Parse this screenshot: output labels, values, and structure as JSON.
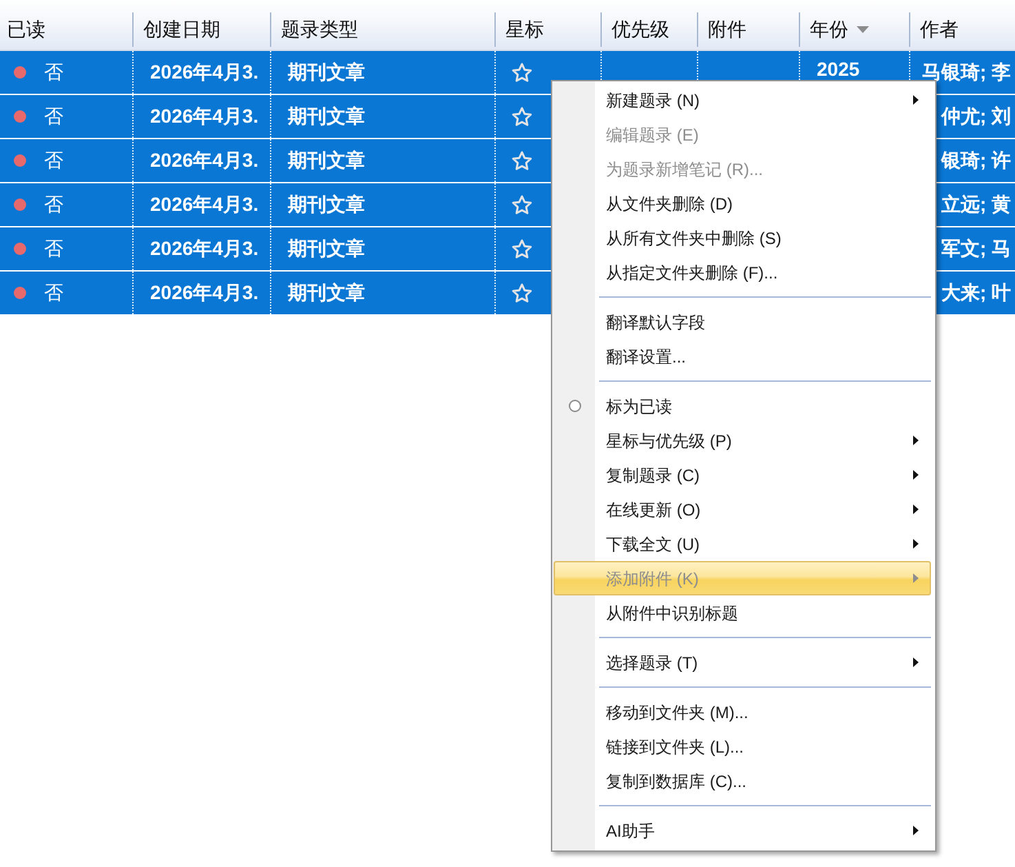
{
  "table": {
    "columns": [
      {
        "label": "已读"
      },
      {
        "label": "创建日期"
      },
      {
        "label": "题录类型"
      },
      {
        "label": "星标"
      },
      {
        "label": "优先级"
      },
      {
        "label": "附件"
      },
      {
        "label": "年份",
        "sorted": true,
        "descending": true
      },
      {
        "label": "作者"
      }
    ],
    "rows": [
      {
        "selected": true,
        "unread": true,
        "read": "否",
        "created": "2026年4月3.",
        "type": "期刊文章",
        "starred": false,
        "year": "2025",
        "authors": "马银琦; 李"
      },
      {
        "selected": true,
        "unread": true,
        "read": "否",
        "created": "2026年4月3.",
        "type": "期刊文章",
        "starred": false,
        "authors": "仲尤; 刘"
      },
      {
        "selected": true,
        "unread": true,
        "read": "否",
        "created": "2026年4月3.",
        "type": "期刊文章",
        "starred": false,
        "authors": "银琦; 许"
      },
      {
        "selected": true,
        "unread": true,
        "read": "否",
        "created": "2026年4月3.",
        "type": "期刊文章",
        "starred": false,
        "authors": "立远; 黄"
      },
      {
        "selected": true,
        "unread": true,
        "read": "否",
        "created": "2026年4月3.",
        "type": "期刊文章",
        "starred": false,
        "authors": "军文; 马"
      },
      {
        "selected": true,
        "unread": true,
        "read": "否",
        "created": "2026年4月3.",
        "type": "期刊文章",
        "starred": false,
        "authors": "大来; 叶"
      }
    ]
  },
  "context_menu": {
    "items": [
      {
        "kind": "item",
        "label": "新建题录 (N)",
        "disabled": false,
        "submenu": true,
        "selected": false
      },
      {
        "kind": "item",
        "label": "编辑题录 (E)",
        "disabled": true,
        "submenu": false,
        "selected": false
      },
      {
        "kind": "item",
        "label": "为题录新增笔记 (R)...",
        "disabled": true,
        "submenu": false,
        "selected": false
      },
      {
        "kind": "item",
        "label": "从文件夹删除 (D)",
        "disabled": false,
        "submenu": false,
        "selected": false
      },
      {
        "kind": "item",
        "label": "从所有文件夹中删除 (S)",
        "disabled": false,
        "submenu": false,
        "selected": false
      },
      {
        "kind": "item",
        "label": "从指定文件夹删除 (F)...",
        "disabled": false,
        "submenu": false,
        "selected": false
      },
      {
        "kind": "separator"
      },
      {
        "kind": "item",
        "label": "翻译默认字段",
        "disabled": false,
        "submenu": false,
        "selected": false
      },
      {
        "kind": "item",
        "label": "翻译设置...",
        "disabled": false,
        "submenu": false,
        "selected": false
      },
      {
        "kind": "separator"
      },
      {
        "kind": "radio",
        "label": "标为已读",
        "checked": false,
        "disabled": false,
        "submenu": false,
        "selected": false
      },
      {
        "kind": "item",
        "label": "星标与优先级 (P)",
        "disabled": false,
        "submenu": true,
        "selected": false
      },
      {
        "kind": "item",
        "label": "复制题录 (C)",
        "disabled": false,
        "submenu": true,
        "selected": false
      },
      {
        "kind": "item",
        "label": "在线更新 (O)",
        "disabled": false,
        "submenu": true,
        "selected": false
      },
      {
        "kind": "item",
        "label": "下载全文 (U)",
        "disabled": false,
        "submenu": true,
        "selected": false
      },
      {
        "kind": "item",
        "label": "添加附件 (K)",
        "disabled": true,
        "submenu": true,
        "selected": true
      },
      {
        "kind": "item",
        "label": "从附件中识别标题",
        "disabled": false,
        "submenu": false,
        "selected": false
      },
      {
        "kind": "separator"
      },
      {
        "kind": "item",
        "label": "选择题录 (T)",
        "disabled": false,
        "submenu": true,
        "selected": false
      },
      {
        "kind": "separator"
      },
      {
        "kind": "item",
        "label": "移动到文件夹 (M)...",
        "disabled": false,
        "submenu": false,
        "selected": false
      },
      {
        "kind": "item",
        "label": "链接到文件夹 (L)...",
        "disabled": false,
        "submenu": false,
        "selected": false
      },
      {
        "kind": "item",
        "label": "复制到数据库 (C)...",
        "disabled": false,
        "submenu": false,
        "selected": false
      },
      {
        "kind": "separator"
      },
      {
        "kind": "item",
        "label": "AI助手",
        "disabled": false,
        "submenu": true,
        "selected": false
      }
    ]
  }
}
